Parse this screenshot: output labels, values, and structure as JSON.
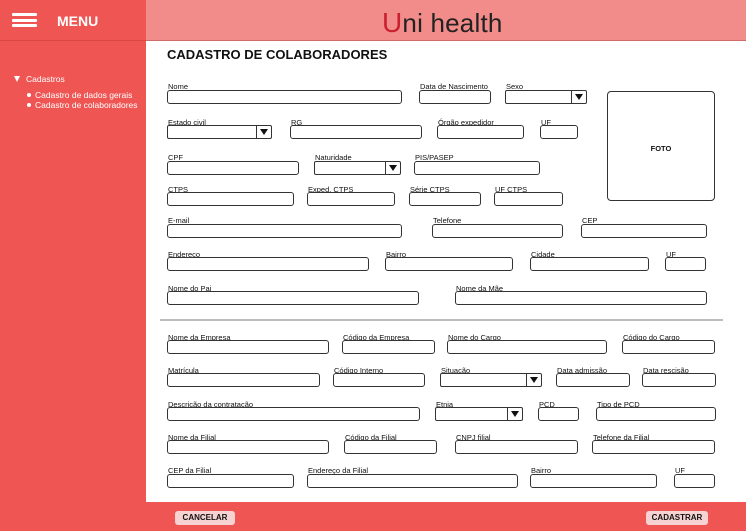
{
  "menu": {
    "label": "MENU",
    "icon": "hamburger-menu-icon"
  },
  "nav": {
    "root": "Cadastros",
    "children": [
      "Cadastro de dados gerais",
      "Cadastro de colaboradores"
    ]
  },
  "header": {
    "logo_mark": "U",
    "logo_text": "ni health"
  },
  "page": {
    "title": "CADASTRO DE COLABORADORES"
  },
  "form": {
    "nome": "Nome",
    "data_nascimento": "Data de Nascimento",
    "sexo": "Sexo",
    "foto": "FOTO",
    "estado_civil": "Estado civil",
    "rg": "RG",
    "orgao_expedidor": "Órgão expedidor",
    "uf_rg": "UF",
    "cpf": "CPF",
    "naturalidade": "Naturidade",
    "pis_pasep": "PIS/PASEP",
    "ctps": "CTPS",
    "exped_ctps": "Exped. CTPS",
    "serie_ctps": "Série CTPS",
    "uf_ctps": "UF CTPS",
    "email": "E-mail",
    "telefone": "Telefone",
    "cep": "CEP",
    "endereco": "Endereço",
    "bairro": "Bairro",
    "cidade": "Cidade",
    "uf_endereco": "UF",
    "nome_pai": "Nome do Pai",
    "nome_mae": "Nome da Mãe",
    "nome_empresa": "Nome da Empresa",
    "codigo_empresa": "Código da Empresa",
    "nome_cargo": "Nome do Cargo",
    "codigo_cargo": "Código do Cargo",
    "matricula": "Matrícula",
    "codigo_interno": "Código Interno",
    "situacao": "Situação",
    "data_admissao": "Data admissão",
    "data_rescisao": "Data rescisão",
    "descricao_contratacao": "Descrição da contratação",
    "etnia": "Etnia",
    "pcd": "PCD",
    "tipo_pcd": "Tipo de PCD",
    "nome_filial": "Nome da Filial",
    "codigo_filial": "Código da Filial",
    "cnpj_filial": "CNPJ filial",
    "telefone_filial": "Telefone da Filial",
    "cep_filial": "CEP da Filial",
    "endereco_filial": "Endereço da Filial",
    "bairro_filial": "Bairro",
    "uf_filial": "UF"
  },
  "footer": {
    "cancel_label": "CANCELAR",
    "submit_label": "CADASTRAR"
  },
  "colors": {
    "sidebar": "#ee5553",
    "topbar": "#f28c8a",
    "logo_accent": "#c8202e",
    "button_bg": "#f6d3d2"
  }
}
